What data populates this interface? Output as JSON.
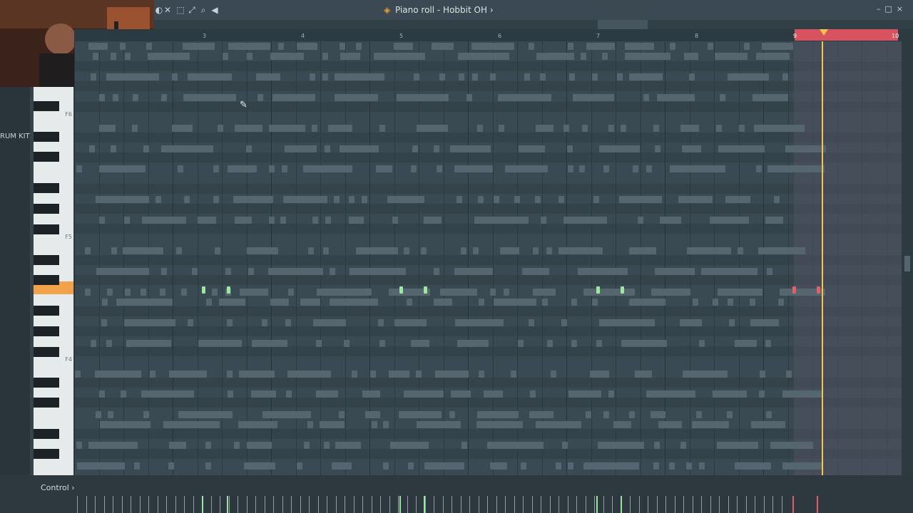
{
  "window": {
    "title": "Piano roll - Hobbit OH",
    "title_suffix": "›",
    "controls": [
      "–",
      "□",
      "×"
    ]
  },
  "toolbar_icons": [
    "stamp-icon",
    "mute-icon",
    "select-icon",
    "zoom-fit-icon",
    "zoom-icon",
    "playback-icon"
  ],
  "sidebar": {
    "channel_label": "RUM KIT"
  },
  "keyboard": {
    "octave_labels": [
      "F6",
      "F5",
      "F4"
    ]
  },
  "ruler": {
    "bars": [
      "3",
      "4",
      "5",
      "6",
      "7",
      "8",
      "9",
      "10"
    ]
  },
  "control": {
    "label": "Control",
    "arrow": "›"
  },
  "colors": {
    "note": "#55666f",
    "selected_note": "#9be79e",
    "loop_region": "#d8525f",
    "playhead": "#f4c64a",
    "active_key": "#f2a24a"
  }
}
